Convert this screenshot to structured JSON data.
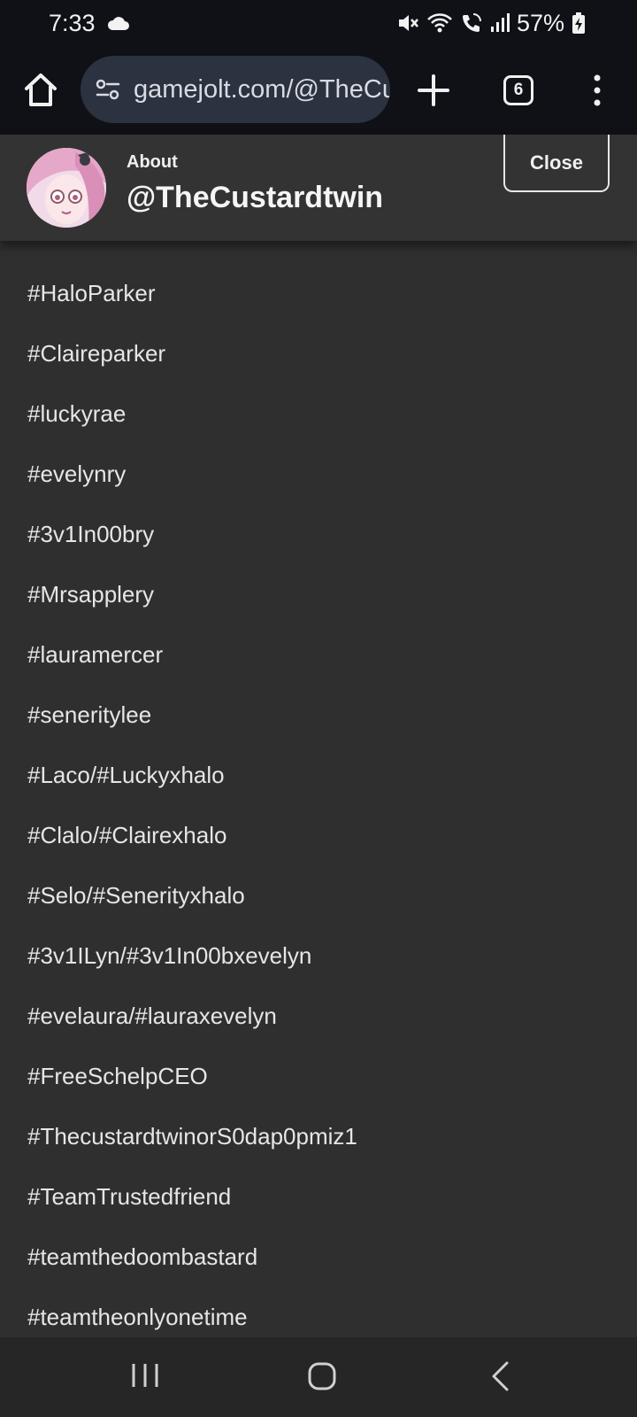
{
  "status": {
    "time": "7:33",
    "battery": "57%"
  },
  "browser": {
    "url": "gamejolt.com/@TheCustardtwin",
    "tab_count": "6"
  },
  "modal": {
    "about_label": "About",
    "username": "@TheCustardtwin",
    "close_label": "Close"
  },
  "tags": [
    "#HaloParker",
    "#Claireparker",
    "#luckyrae",
    "#evelynry",
    "#3v1In00bry",
    "#Mrsapplery",
    "#lauramercer",
    "#seneritylee",
    "#Laco/#Luckyxhalo",
    "#Clalo/#Clairexhalo",
    "#Selo/#Senerityxhalo",
    "#3v1ILyn/#3v1In00bxevelyn",
    "#evelaura/#lauraxevelyn",
    "#FreeSchelpCEO",
    "#ThecustardtwinorS0dap0pmiz1",
    "#TeamTrustedfriend",
    "#teamthedoombastard",
    "#teamtheonlyonetime"
  ]
}
